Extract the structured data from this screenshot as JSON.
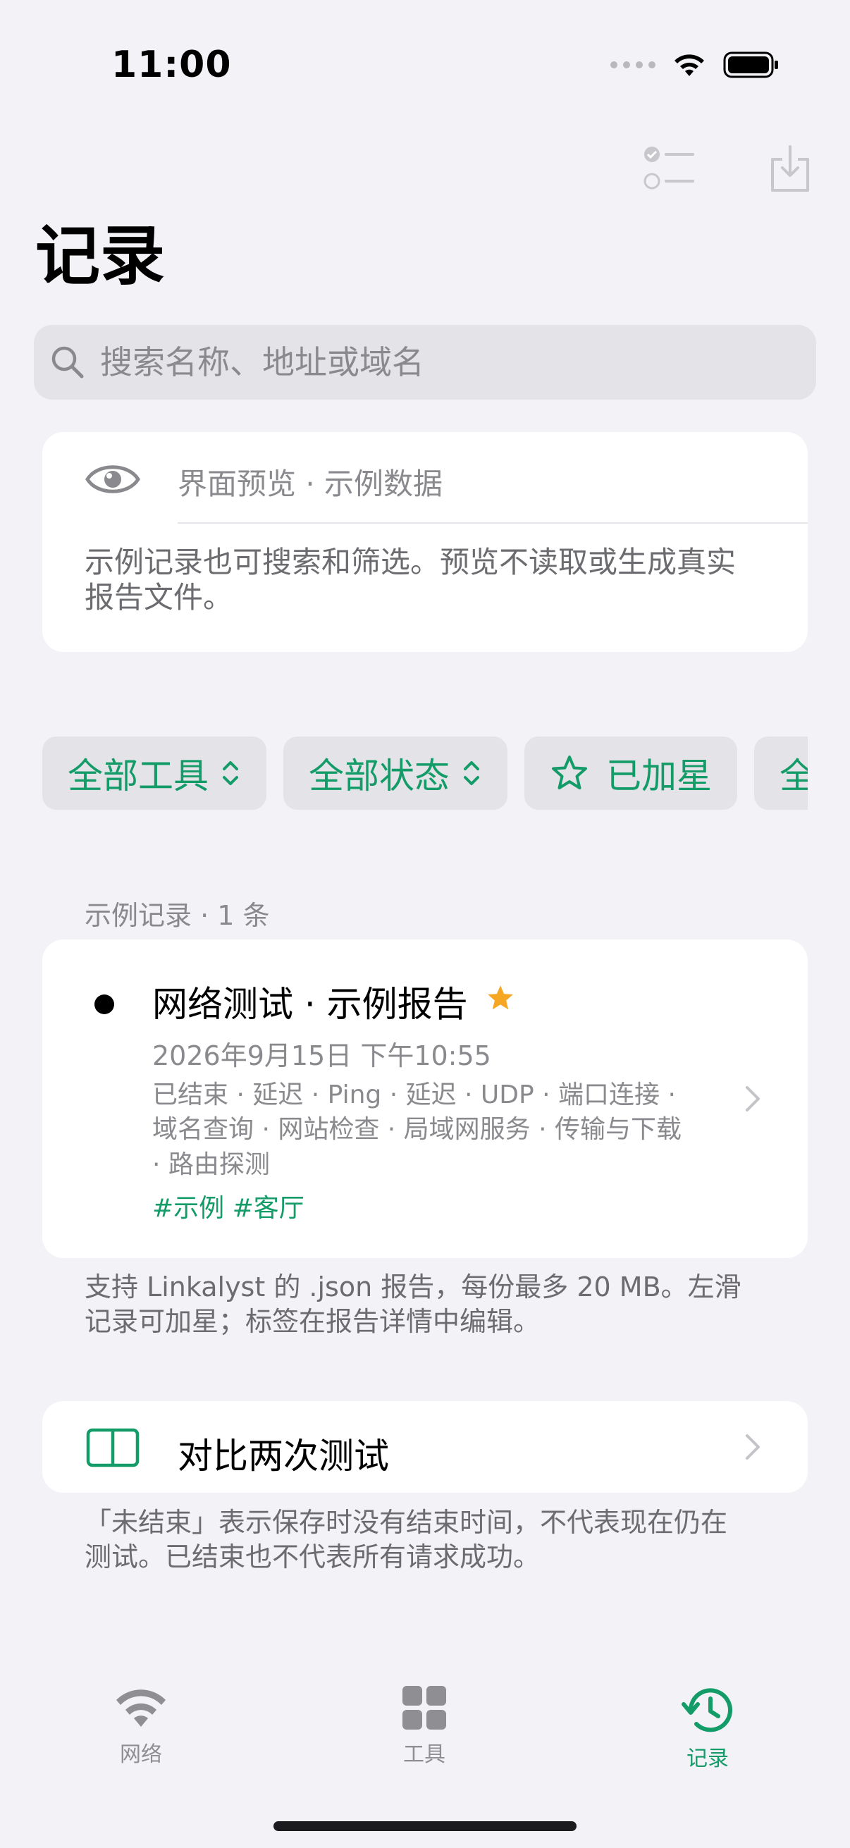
{
  "status_bar": {
    "time": "11:00"
  },
  "header": {
    "title": "记录"
  },
  "search": {
    "placeholder": "搜索名称、地址或域名"
  },
  "preview": {
    "title": "界面预览 · 示例数据",
    "description": "示例记录也可搜索和筛选。预览不读取或生成真实报告文件。"
  },
  "filters": [
    {
      "label": "全部工具",
      "icon": "chevron-up-down-icon"
    },
    {
      "label": "全部状态",
      "icon": "chevron-up-down-icon"
    },
    {
      "label": "已加星",
      "icon": "star-outline-icon"
    },
    {
      "label": "全"
    }
  ],
  "records_section": {
    "header": "示例记录 · 1 条"
  },
  "record": {
    "title": "网络测试 · 示例报告",
    "starred": true,
    "date": "2026年9月15日 下午10:55",
    "tools_line1": "已结束 · 延迟 · Ping · 延迟 · UDP · 端口连接 ·",
    "tools_line2": "域名查询 · 网站检查 · 局域网服务 · 传输与下载",
    "tools_line3": "· 路由探测",
    "tags": "#示例 #客厅"
  },
  "import_note": {
    "line1": "支持 Linkalyst 的 .json 报告，每份最多 20 MB。左滑",
    "line2": "记录可加星；标签在报告详情中编辑。"
  },
  "compare": {
    "label": "对比两次测试"
  },
  "status_note": {
    "line1": "「未结束」表示保存时没有结束时间，不代表现在仍在",
    "line2": "测试。已结束也不代表所有请求成功。"
  },
  "tabs": [
    {
      "label": "网络",
      "icon": "wifi-icon",
      "active": false
    },
    {
      "label": "工具",
      "icon": "grid-icon",
      "active": false
    },
    {
      "label": "记录",
      "icon": "history-icon",
      "active": true
    }
  ],
  "colors": {
    "accent": "#139B68",
    "star": "#F5A623",
    "background": "#F2F2F7"
  }
}
